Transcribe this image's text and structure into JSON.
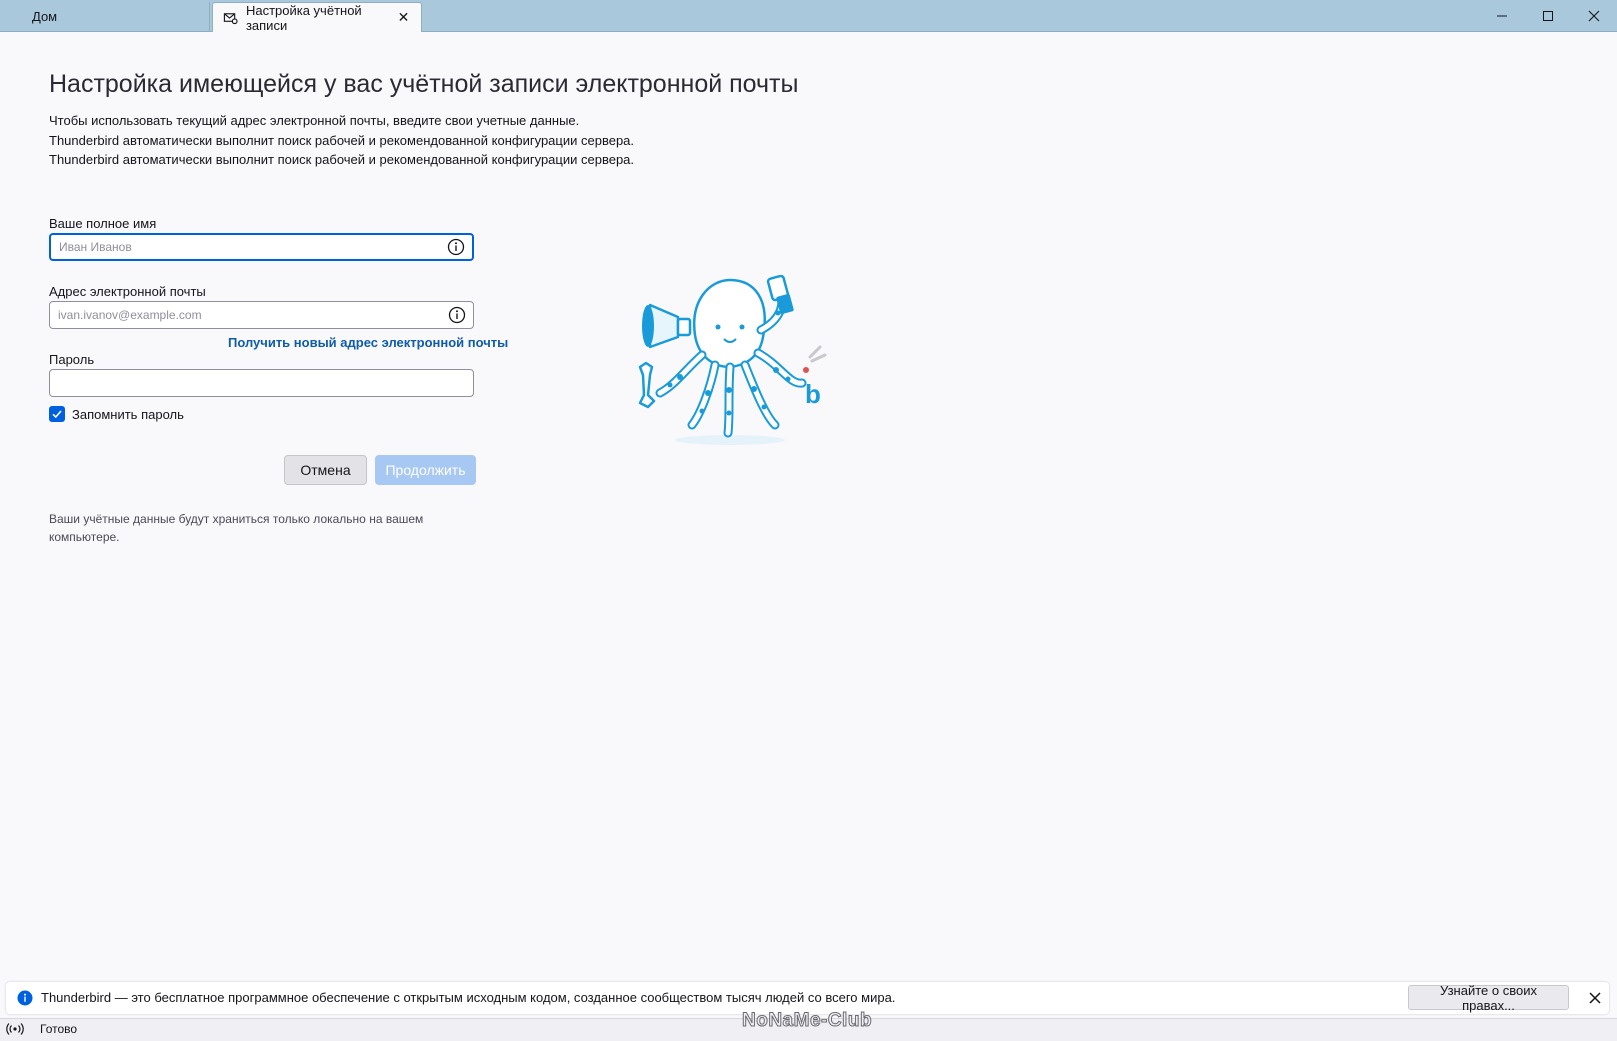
{
  "tabs": {
    "home_label": "Дом",
    "account_setup_label": "Настройка учётной записи"
  },
  "page": {
    "title": "Настройка имеющейся у вас учётной записи электронной почты",
    "description": [
      "Чтобы использовать текущий адрес электронной почты, введите свои учетные данные.",
      "Thunderbird автоматически выполнит поиск рабочей и рекомендованной конфигурации сервера.",
      "Thunderbird автоматически выполнит поиск рабочей и рекомендованной конфигурации сервера."
    ]
  },
  "form": {
    "name_label": "Ваше полное имя",
    "name_placeholder": "Иван Иванов",
    "name_value": "",
    "email_label": "Адрес электронной почты",
    "email_placeholder": "ivan.ivanov@example.com",
    "email_value": "",
    "new_email_link": "Получить новый адрес электронной почты",
    "password_label": "Пароль",
    "password_value": "",
    "remember_label": "Запомнить пароль",
    "remember_checked": true,
    "cancel_label": "Отмена",
    "continue_label": "Продолжить",
    "local_note": "Ваши учётные данные будут храниться только локально на вашем компьютере."
  },
  "notification": {
    "text": "Thunderbird — это бесплатное программное обеспечение с открытым исходным кодом, созданное сообществом тысяч людей со всего мира.",
    "button_label": "Узнайте о своих правах..."
  },
  "status": {
    "text": "Готово"
  },
  "watermark": "NoNaMe-Club",
  "colors": {
    "titlebar": "#a9c8dc",
    "accent": "#0061e0",
    "link": "#0f5ca8",
    "mascot": "#1a9bd9"
  }
}
